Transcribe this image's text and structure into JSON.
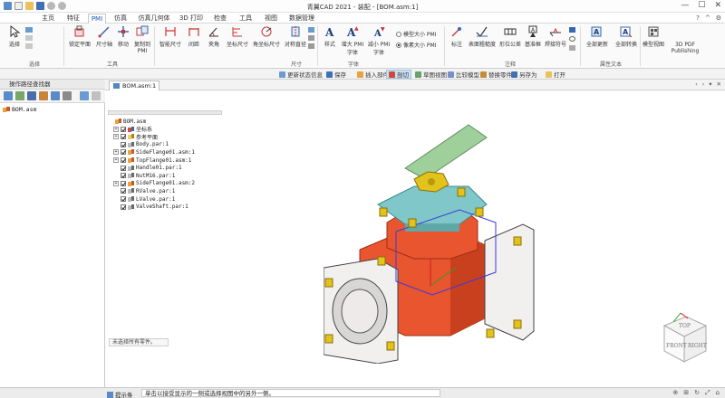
{
  "app": {
    "title": "青翼CAD 2021 - 装配 - [BOM.asm:1]",
    "quick_access": [
      "home-icon",
      "new-icon",
      "open-icon",
      "save-icon",
      "undo-icon",
      "redo-icon"
    ],
    "window_controls": [
      "—",
      "☐",
      "✕"
    ]
  },
  "tabs": [
    {
      "label": "主页",
      "active": false
    },
    {
      "label": "特征",
      "active": false
    },
    {
      "label": "PMI",
      "active": true
    },
    {
      "label": "仿真",
      "active": false
    },
    {
      "label": "仿真几何体",
      "active": false
    },
    {
      "label": "3D 打印",
      "active": false
    },
    {
      "label": "检查",
      "active": false
    },
    {
      "label": "工具",
      "active": false
    },
    {
      "label": "视图",
      "active": false
    },
    {
      "label": "数据管理",
      "active": false
    }
  ],
  "tab_controls": [
    "?",
    "^",
    "⚙"
  ],
  "ribbon": {
    "buttons": [
      {
        "label": "选择",
        "icon": "cursor-icon"
      },
      {
        "label": "锁定平面",
        "icon": "lock-plane-icon"
      },
      {
        "label": "尺寸轴",
        "icon": "dim-axis-icon"
      },
      {
        "label": "移动",
        "icon": "move-icon"
      },
      {
        "label": "复制到 PMI",
        "icon": "copy-pmi-icon"
      },
      {
        "label": "智能尺寸",
        "icon": "smart-dimension-icon"
      },
      {
        "label": "间距",
        "icon": "distance-icon"
      },
      {
        "label": "夹角",
        "icon": "angle-icon"
      },
      {
        "label": "坐标尺寸",
        "icon": "coordinate-dim-icon"
      },
      {
        "label": "角坐标尺寸",
        "icon": "angular-coord-icon"
      },
      {
        "label": "对称直径",
        "icon": "symmetric-diameter-icon"
      },
      {
        "label": "样式",
        "icon": "style-icon"
      },
      {
        "label": "增大 PMI 字体",
        "icon": "font-grow-icon"
      },
      {
        "label": "减小 PMI 字体",
        "icon": "font-shrink-icon"
      },
      {
        "label": "标注",
        "icon": "callout-icon"
      },
      {
        "label": "表面粗糙度",
        "icon": "surface-finish-icon"
      },
      {
        "label": "形位公差",
        "icon": "fcf-icon"
      },
      {
        "label": "基准框",
        "icon": "datum-frame-icon"
      },
      {
        "label": "焊接符号",
        "icon": "weld-symbol-icon"
      },
      {
        "label": "全部更新",
        "icon": "update-all-icon"
      },
      {
        "label": "全部转换",
        "icon": "convert-all-icon"
      },
      {
        "label": "模型视图",
        "icon": "model-view-icon"
      },
      {
        "label": "3D PDF Publishing",
        "icon": "pdf-publishing-icon"
      }
    ],
    "groups": [
      "选择",
      "工具",
      "尺寸",
      "字体",
      "注释",
      "属性文本"
    ],
    "pmi_options": [
      {
        "label": "模型大小 PMI",
        "selected": false
      },
      {
        "label": "像素大小 PMI",
        "selected": true
      }
    ]
  },
  "command_bar": [
    {
      "label": "更新状态信息",
      "active": false
    },
    {
      "label": "保存",
      "active": false
    },
    {
      "label": "插入部件",
      "active": false
    },
    {
      "label": "剖切",
      "active": true
    },
    {
      "label": "草图视图",
      "active": false
    },
    {
      "label": "比较模型",
      "active": false
    },
    {
      "label": "替换零件",
      "active": false
    },
    {
      "label": "另存为",
      "active": false
    },
    {
      "label": "打开",
      "active": false
    }
  ],
  "left_panel": {
    "title": "操作路径查找器",
    "root_item": "BOM.asm"
  },
  "document_tab": {
    "label": "BOM.asm:1"
  },
  "nav_controls": [
    "‹",
    "›",
    "▾",
    "✕"
  ],
  "assembly_tree": [
    {
      "label": "BOM.asm",
      "level": 0,
      "icon": "assembly",
      "expander": ""
    },
    {
      "label": "坐标系",
      "level": 1,
      "icon": "csys",
      "expander": "+"
    },
    {
      "label": "参考平面",
      "level": 1,
      "icon": "planes",
      "expander": "+"
    },
    {
      "label": "Body.par:1",
      "level": 1,
      "icon": "part",
      "expander": ""
    },
    {
      "label": "SideFlange01.asm:1",
      "level": 1,
      "icon": "assembly",
      "expander": "+"
    },
    {
      "label": "TopFlange01.asm:1",
      "level": 1,
      "icon": "assembly",
      "expander": "+"
    },
    {
      "label": "Handle01.par:1",
      "level": 1,
      "icon": "part",
      "expander": ""
    },
    {
      "label": "NutM16.par:1",
      "level": 1,
      "icon": "part",
      "expander": ""
    },
    {
      "label": "SideFlange01.asm:2",
      "level": 1,
      "icon": "assembly",
      "expander": "+"
    },
    {
      "label": "RValve.par:1",
      "level": 1,
      "icon": "part",
      "expander": ""
    },
    {
      "label": "LValve.par:1",
      "level": 1,
      "icon": "part",
      "expander": ""
    },
    {
      "label": "ValveShaft.par:1",
      "level": 1,
      "icon": "part",
      "expander": ""
    }
  ],
  "tree_status": "未选择所有零件。",
  "view_cube": {
    "top": "TOP",
    "front": "FRONT",
    "right": "RIGHT"
  },
  "status_bar": {
    "label": "提示条",
    "prompt": "单击以接受显示的一侧或选择视图中的另外一侧。",
    "controls": [
      "⊕",
      "⊞",
      "↻",
      "⤢",
      "⌂"
    ]
  },
  "colors": {
    "accent": "#1a56b0",
    "valve_body": "#e8552e",
    "flange": "#7fc7c8",
    "handle": "#9fcf9b",
    "bolt": "#e3c21c"
  }
}
